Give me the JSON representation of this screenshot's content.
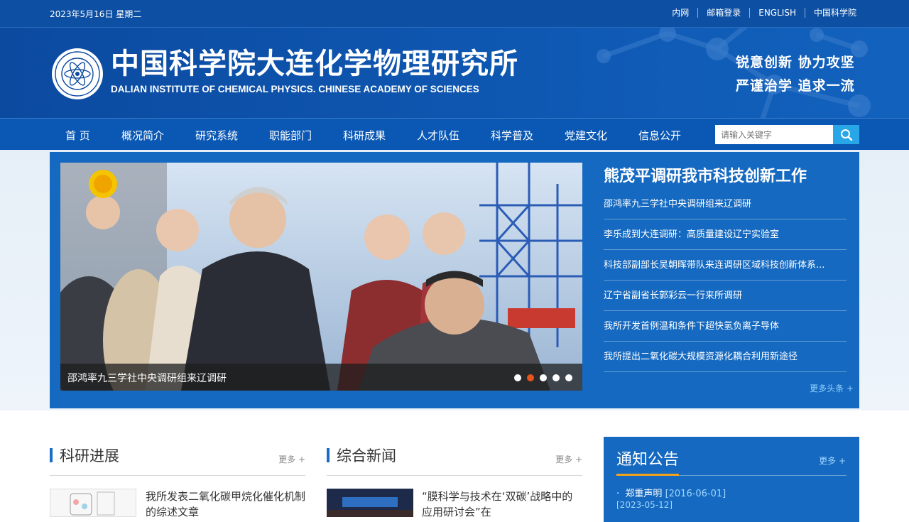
{
  "topbar": {
    "date": "2023年5月16日 星期二",
    "links": [
      "内网",
      "邮箱登录",
      "ENGLISH",
      "中国科学院"
    ]
  },
  "header": {
    "title_cn": "中国科学院大连化学物理研究所",
    "title_en": "DALIAN INSTITUTE OF CHEMICAL PHYSICS. CHINESE ACADEMY OF SCIENCES",
    "slogan_line1": "锐意创新  协力攻坚",
    "slogan_line2": "严谨治学  追求一流"
  },
  "nav": {
    "items": [
      "首 页",
      "概况简介",
      "研究系统",
      "职能部门",
      "科研成果",
      "人才队伍",
      "科学普及",
      "党建文化",
      "信息公开"
    ],
    "search_placeholder": "请输入关键字"
  },
  "headlines": {
    "slider_caption": "邵鸿率九三学社中央调研组来辽调研",
    "slide_count": 5,
    "active_slide": 2,
    "title": "熊茂平调研我市科技创新工作",
    "items": [
      "邵鸿率九三学社中央调研组来辽调研",
      "李乐成到大连调研：高质量建设辽宁实验室",
      "科技部副部长吴朝晖带队来连调研区域科技创新体系...",
      "辽宁省副省长郭彩云一行来所调研",
      "我所开发首例温和条件下超快氢负离子导体",
      "我所提出二氧化碳大规模资源化耦合利用新途径"
    ],
    "more": "更多头条 +"
  },
  "research": {
    "title": "科研进展",
    "more": "更多 +",
    "first_item": "我所发表二氧化碳甲烷化催化机制的综述文章"
  },
  "news": {
    "title": "综合新闻",
    "more": "更多 +",
    "first_item": "“膜科学与技术在‘双碳’战略中的应用研讨会”在"
  },
  "notice": {
    "title": "通知公告",
    "more": "更多 +",
    "items": [
      {
        "text": "郑重声明",
        "date": "[2016-06-01]"
      }
    ],
    "second_date": "[2023-05-12]"
  },
  "colors": {
    "primary_blue": "#1569c0",
    "nav_blue": "#0a58b4",
    "accent_orange": "#e8541b",
    "search_button": "#29a6e8"
  }
}
